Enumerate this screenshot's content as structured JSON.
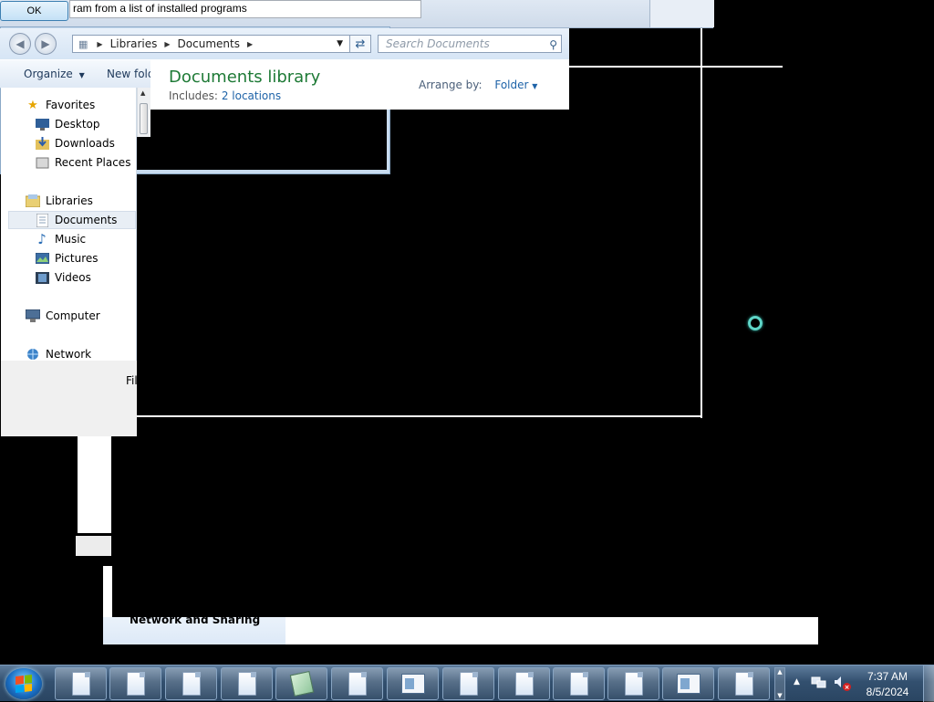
{
  "dialog": {
    "ok_label": "OK",
    "program_text": "ram from a list of installed programs"
  },
  "explorer": {
    "address": [
      "Libraries",
      "Documents"
    ],
    "search_placeholder": "Search Documents",
    "toolbar": {
      "organize": "Organize",
      "new_folder": "New folder"
    },
    "library_title": "Documents library",
    "includes_label": "Includes:",
    "includes_link": "2 locations",
    "arrange_label": "Arrange by:",
    "arrange_value": "Folder",
    "nav": [
      {
        "label": "Favorites",
        "icon": "star-icon"
      },
      {
        "label": "Desktop",
        "icon": "desktop-icon"
      },
      {
        "label": "Downloads",
        "icon": "downloads-icon"
      },
      {
        "label": "Recent Places",
        "icon": "recent-places-icon"
      },
      {
        "label": "Libraries",
        "icon": "libraries-icon"
      },
      {
        "label": "Documents",
        "icon": "documents-icon",
        "selected": true
      },
      {
        "label": "Music",
        "icon": "music-icon"
      },
      {
        "label": "Pictures",
        "icon": "pictures-icon"
      },
      {
        "label": "Videos",
        "icon": "videos-icon"
      },
      {
        "label": "Computer",
        "icon": "computer-icon"
      },
      {
        "label": "Network",
        "icon": "network-icon"
      }
    ],
    "partial_text": "Fil"
  },
  "background": {
    "network_label": "Network and Sharing"
  },
  "taskbar": {
    "time": "7:37 AM",
    "date": "8/5/2024",
    "items": [
      "document",
      "document",
      "document",
      "document",
      "notepad",
      "document",
      "app-window",
      "document",
      "document",
      "document",
      "document",
      "app-window",
      "document"
    ]
  }
}
